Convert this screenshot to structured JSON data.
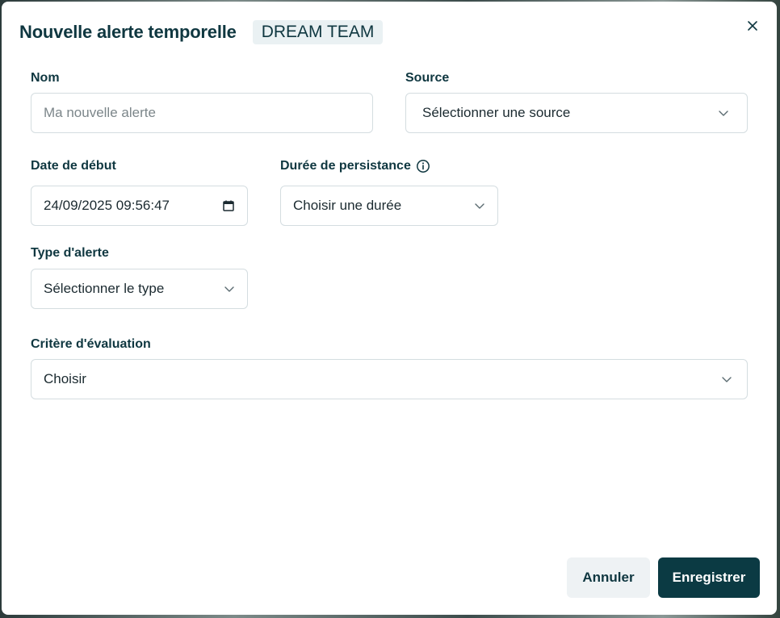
{
  "modal": {
    "title": "Nouvelle alerte temporelle",
    "team_badge": "DREAM TEAM",
    "close_icon": "close-icon"
  },
  "form": {
    "name": {
      "label": "Nom",
      "placeholder": "Ma nouvelle alerte",
      "value": ""
    },
    "source": {
      "label": "Source",
      "selected": "Sélectionner une source"
    },
    "start_date": {
      "label": "Date de début",
      "value": "24/09/2025 09:56:47"
    },
    "persistence": {
      "label": "Durée de persistance",
      "selected": "Choisir une durée",
      "icon": "info-icon"
    },
    "alert_type": {
      "label": "Type d'alerte",
      "selected": "Sélectionner le type"
    },
    "criteria": {
      "label": "Critère d'évaluation",
      "selected": "Choisir"
    }
  },
  "actions": {
    "cancel_label": "Annuler",
    "save_label": "Enregistrer"
  },
  "colors": {
    "primary": "#0b3a43",
    "text": "#0f3740",
    "badge_bg": "#eaf1f3",
    "border": "#d4dde0",
    "cancel_bg": "#eef2f4"
  }
}
